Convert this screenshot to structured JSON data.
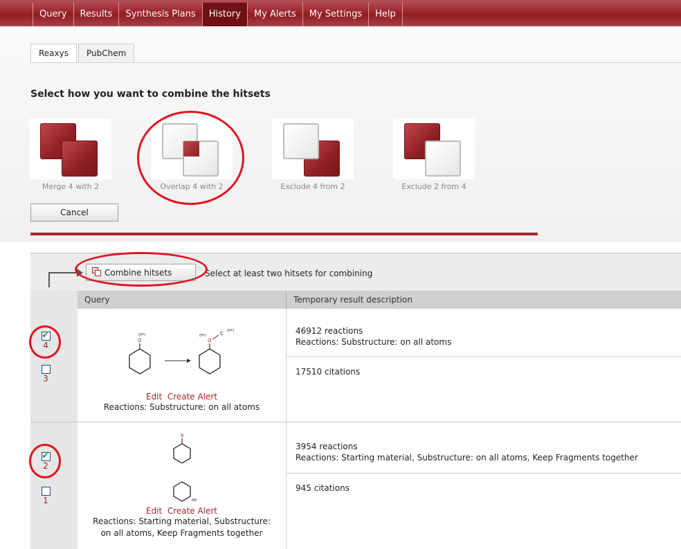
{
  "nav": {
    "tabs": [
      "Query",
      "Results",
      "Synthesis Plans",
      "History",
      "My Alerts",
      "My Settings",
      "Help"
    ],
    "active": "History"
  },
  "subtabs": {
    "items": [
      "Reaxys",
      "PubChem"
    ],
    "active": "Reaxys"
  },
  "combine": {
    "title": "Select how you want to combine the hitsets",
    "options": [
      {
        "label": "Merge 4 with 2",
        "icon": "merge-icon"
      },
      {
        "label": "Overlap 4 with 2",
        "icon": "overlap-icon"
      },
      {
        "label": "Exclude 4 from 2",
        "icon": "exclude-first-icon"
      },
      {
        "label": "Exclude 2 from 4",
        "icon": "exclude-second-icon"
      }
    ],
    "cancel_label": "Cancel"
  },
  "hitsets": {
    "combine_button": "Combine hitsets",
    "hint": "Select at least two hitsets for combining",
    "columns": [
      "Query",
      "Temporary result description"
    ],
    "edit_label": "Edit",
    "alert_label": "Create Alert",
    "rows": [
      {
        "checkboxes": [
          {
            "num": "4",
            "checked": true
          },
          {
            "num": "3",
            "checked": false
          }
        ],
        "query_desc": "Reactions: Substructure: on all atoms",
        "results": [
          {
            "line1": "46912 reactions",
            "line2": "Reactions: Substructure: on all atoms"
          },
          {
            "line1": "17510 citations",
            "line2": ""
          }
        ]
      },
      {
        "checkboxes": [
          {
            "num": "2",
            "checked": true
          },
          {
            "num": "1",
            "checked": false
          }
        ],
        "query_desc": "Reactions: Starting material, Substructure: on all atoms, Keep Fragments together",
        "results": [
          {
            "line1": "3954 reactions",
            "line2": "Reactions: Starting material, Substructure: on all atoms, Keep Fragments together"
          },
          {
            "line1": "945 citations",
            "line2": ""
          }
        ]
      }
    ]
  },
  "colors": {
    "brand_red": "#a4262c",
    "annotation_red": "#e0141d"
  }
}
